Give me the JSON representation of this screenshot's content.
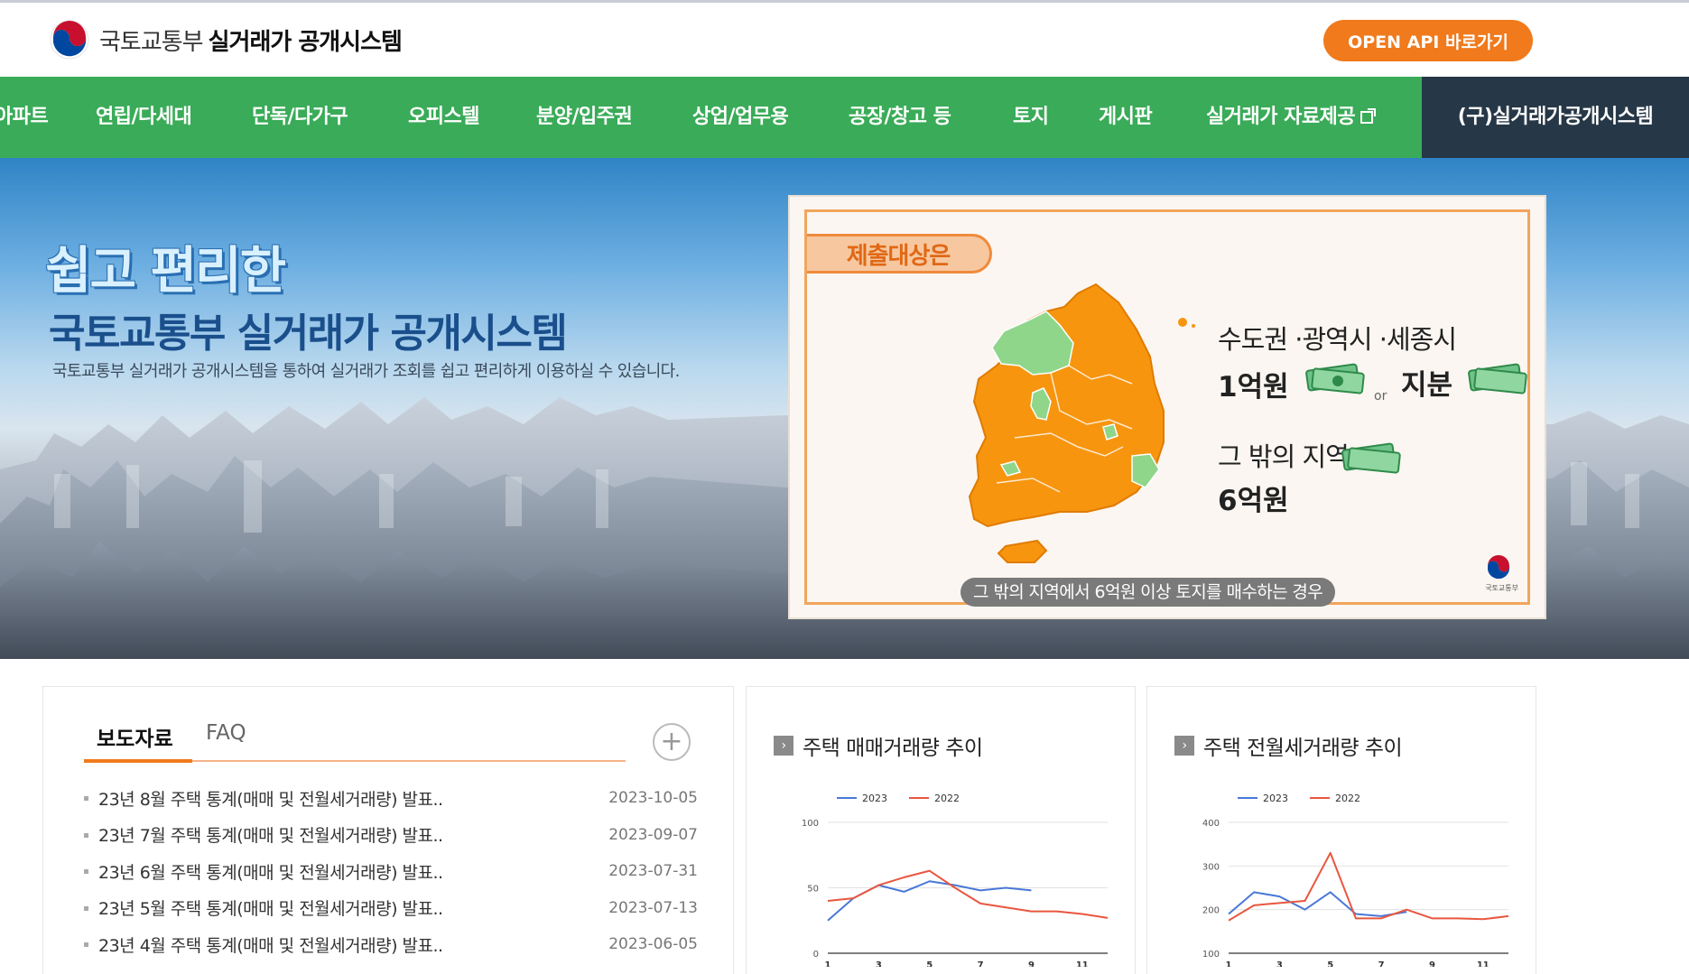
{
  "header": {
    "logo_prefix": "국토교통부",
    "logo_name": "실거래가 공개시스템",
    "api_button": "OPEN API 바로가기"
  },
  "nav": {
    "items": [
      "아파트",
      "연립/다세대",
      "단독/다가구",
      "오피스텔",
      "분양/입주권",
      "상업/업무용",
      "공장/창고 등",
      "토지",
      "게시판",
      "실거래가 자료제공",
      "(구)실거래가공개시스템"
    ]
  },
  "hero": {
    "title1": "쉽고 편리한",
    "title2": "국토교통부 실거래가 공개시스템",
    "desc": "국토교통부 실거래가 공개시스템을 통하여 실거래가 조회를 쉽고 편리하게 이용하실 수 있습니다.",
    "video": {
      "tag": "제출대상은",
      "line1": "수도권 ·광역시 ·세종시",
      "amount1": "1억원",
      "or": "or",
      "share": "지분",
      "line2": "그 밖의 지역",
      "amount2": "6억원",
      "caption": "그 밖의 지역에서 6억원 이상 토지를 매수하는 경우",
      "emblem_caption": "국토교통부"
    }
  },
  "news": {
    "tabs": [
      "보도자료",
      "FAQ"
    ],
    "more": "+",
    "items": [
      {
        "title": "23년 8월 주택 통계(매매 및 전월세거래량) 발표..",
        "date": "2023-10-05"
      },
      {
        "title": "23년 7월 주택 통계(매매 및 전월세거래량) 발표..",
        "date": "2023-09-07"
      },
      {
        "title": "23년 6월 주택 통계(매매 및 전월세거래량) 발표..",
        "date": "2023-07-31"
      },
      {
        "title": "23년 5월 주택 통계(매매 및 전월세거래량) 발표..",
        "date": "2023-07-13"
      },
      {
        "title": "23년 4월 주택 통계(매매 및 전월세거래량) 발표..",
        "date": "2023-06-05"
      }
    ]
  },
  "panels": {
    "sale_title": "주택 매매거래량 추이",
    "rent_title": "주택 전월세거래량 추이"
  },
  "colors": {
    "series_2023": "#4a78d6",
    "series_2022": "#e8573f",
    "nav_green": "#3aab58",
    "accent_orange": "#f07a1c"
  },
  "chart_data": [
    {
      "type": "line",
      "x": [
        1,
        2,
        3,
        4,
        5,
        6,
        7,
        8,
        9,
        10,
        11,
        12
      ],
      "xticks": [
        1,
        3,
        5,
        7,
        9,
        11
      ],
      "yticks": [
        0,
        50,
        100
      ],
      "ylim": [
        0,
        100
      ],
      "series": [
        {
          "name": "2023",
          "values": [
            25,
            42,
            52,
            47,
            55,
            52,
            48,
            50,
            48,
            null,
            null,
            null
          ]
        },
        {
          "name": "2022",
          "values": [
            40,
            42,
            52,
            58,
            63,
            50,
            38,
            35,
            32,
            32,
            30,
            27
          ]
        }
      ]
    },
    {
      "type": "line",
      "x": [
        1,
        2,
        3,
        4,
        5,
        6,
        7,
        8,
        9,
        10,
        11,
        12
      ],
      "xticks": [
        1,
        3,
        5,
        7,
        9,
        11
      ],
      "yticks": [
        100,
        200,
        300,
        400
      ],
      "ylim": [
        100,
        400
      ],
      "series": [
        {
          "name": "2023",
          "values": [
            190,
            240,
            230,
            200,
            240,
            190,
            185,
            195,
            null,
            null,
            null,
            null
          ]
        },
        {
          "name": "2022",
          "values": [
            175,
            210,
            215,
            220,
            330,
            180,
            180,
            200,
            180,
            180,
            178,
            185
          ]
        }
      ]
    }
  ]
}
